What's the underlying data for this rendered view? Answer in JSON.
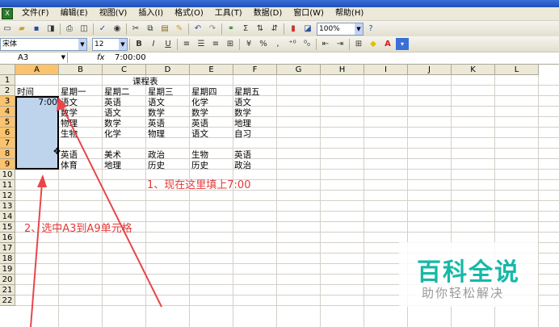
{
  "menubar": {
    "items": [
      "文件(F)",
      "编辑(E)",
      "视图(V)",
      "插入(I)",
      "格式(O)",
      "工具(T)",
      "数据(D)",
      "窗口(W)",
      "帮助(H)"
    ]
  },
  "toolbar": {
    "zoom": "100%",
    "font_name": "宋体",
    "font_size": "12",
    "bold": "B",
    "italic": "I",
    "underline": "U",
    "percent": "%",
    "comma": ","
  },
  "formula_bar": {
    "name_box": "A3",
    "fx": "fx",
    "value": "7:00:00"
  },
  "sheet": {
    "columns": [
      "A",
      "B",
      "C",
      "D",
      "E",
      "F",
      "G",
      "H",
      "I",
      "J",
      "K",
      "L"
    ],
    "rows": [
      "1",
      "2",
      "3",
      "4",
      "5",
      "6",
      "7",
      "8",
      "9",
      "10",
      "11",
      "12",
      "13",
      "14",
      "15",
      "16",
      "17",
      "18",
      "19",
      "20",
      "21",
      "22"
    ],
    "title": "课程表",
    "header": [
      "时间",
      "星期一",
      "星期二",
      "星期三",
      "星期四",
      "星期五"
    ],
    "a3_value": "7:00",
    "schedule": [
      [
        "语文",
        "英语",
        "语文",
        "化学",
        "语文"
      ],
      [
        "数学",
        "语文",
        "数学",
        "数学",
        "数学"
      ],
      [
        "物理",
        "数学",
        "英语",
        "英语",
        "地理"
      ],
      [
        "生物",
        "化学",
        "物理",
        "语文",
        "自习"
      ],
      [
        "",
        "",
        "",
        "",
        ""
      ],
      [
        "英语",
        "美术",
        "政治",
        "生物",
        "英语"
      ],
      [
        "体育",
        "地理",
        "历史",
        "历史",
        "政治"
      ]
    ]
  },
  "annotations": {
    "step1": "1、现在这里填上7:00",
    "step2": "2、选中A3到A9单元格"
  },
  "watermark": {
    "title": "百科全说",
    "subtitle": "助你轻松解决"
  }
}
